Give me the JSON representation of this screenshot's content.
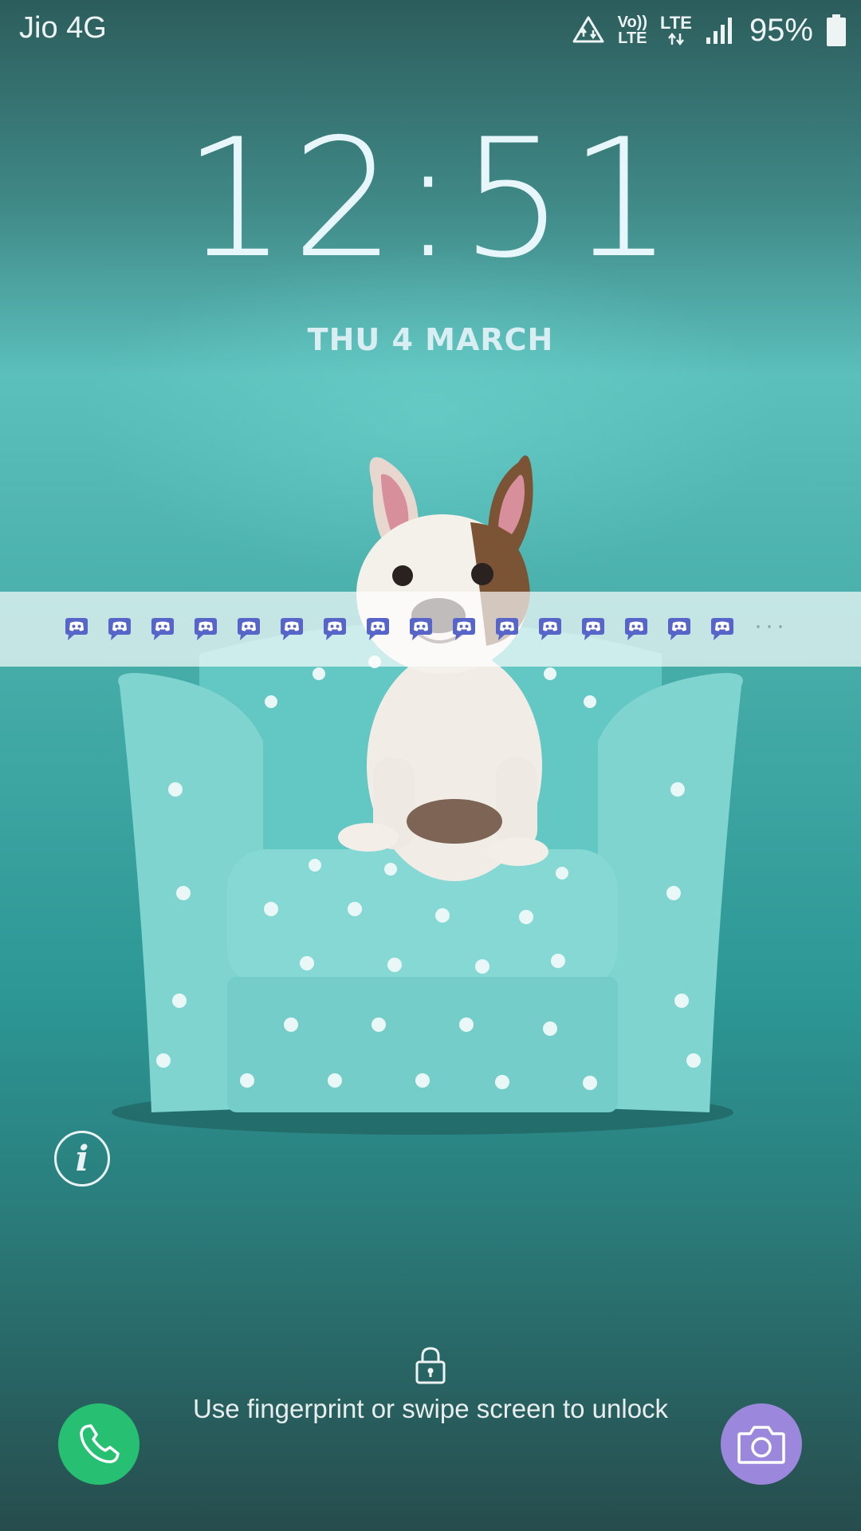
{
  "status_bar": {
    "carrier": "Jio 4G",
    "volte_top": "Vo))",
    "volte_bottom": "LTE",
    "lte": "LTE",
    "battery_percent": "95%"
  },
  "lockscreen": {
    "time": "12:51",
    "date": "THU 4 MARCH",
    "unlock_hint": "Use fingerprint or swipe screen to unlock"
  },
  "notifications": {
    "icon": "discord-icon",
    "icon_color": "#5865c8",
    "count_visible": 16,
    "overflow_indicator": "···"
  },
  "colors": {
    "phone_button": "#27c073",
    "camera_button": "#9b88dc"
  }
}
